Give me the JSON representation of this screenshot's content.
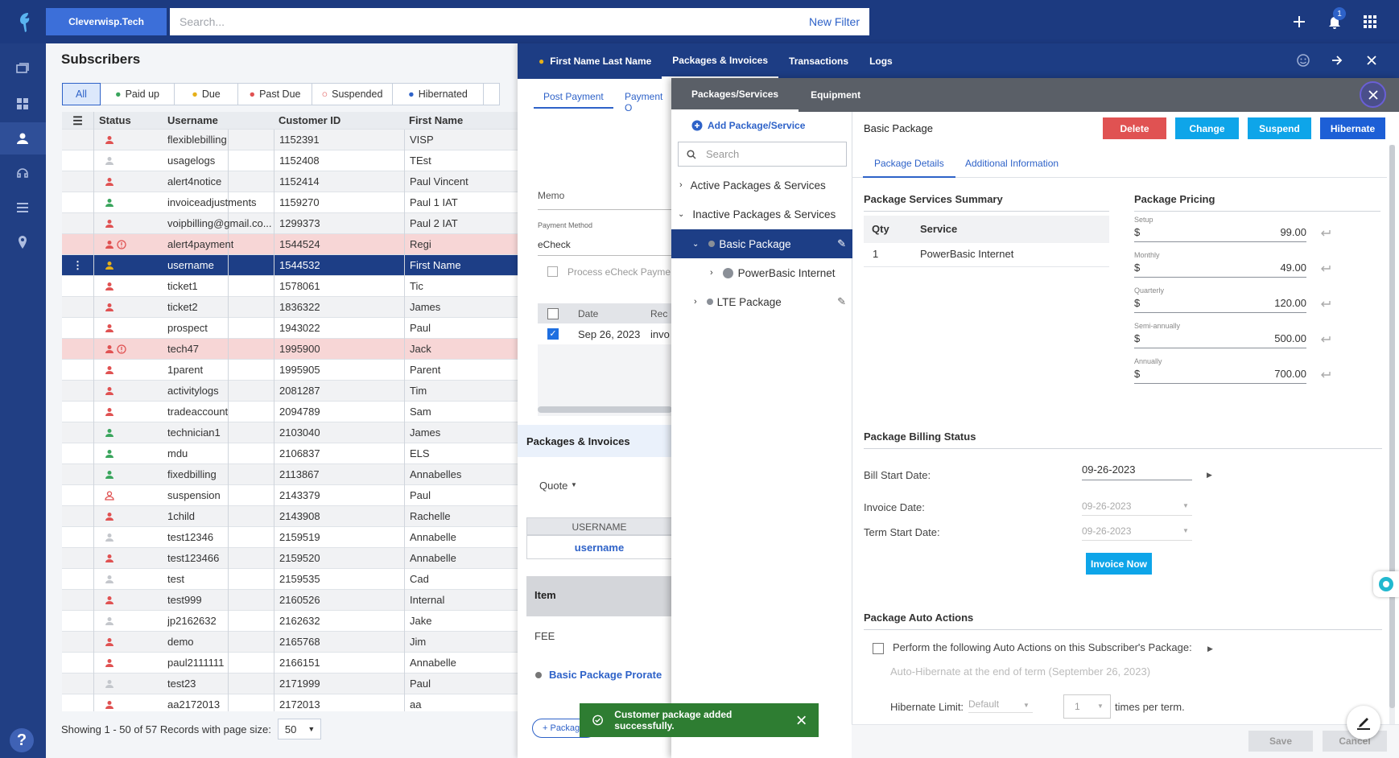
{
  "topbar": {
    "company": "Cleverwisp.Tech",
    "search_placeholder": "Search...",
    "new_filter": "New Filter",
    "notif_count": "1"
  },
  "subscribers": {
    "title": "Subscribers",
    "filters": [
      "All",
      "Paid up",
      "Due",
      "Past Due",
      "Suspended",
      "Hibernated"
    ],
    "columns": [
      "Status",
      "Username",
      "Customer ID",
      "First Name"
    ],
    "rows": [
      {
        "username": "flexiblebilling",
        "id": "1152391",
        "first": "VISP",
        "status": "red"
      },
      {
        "username": "usagelogs",
        "id": "1152408",
        "first": "TEst",
        "status": "gray"
      },
      {
        "username": "alert4notice",
        "id": "1152414",
        "first": "Paul Vincent",
        "status": "red"
      },
      {
        "username": "invoiceadjustments",
        "id": "1159270",
        "first": "Paul 1 IAT",
        "status": "green"
      },
      {
        "username": "voipbilling@gmail.co...",
        "id": "1299373",
        "first": "Paul 2 IAT",
        "status": "red"
      },
      {
        "username": "alert4payment",
        "id": "1544524",
        "first": "Regi",
        "status": "red-alert"
      },
      {
        "username": "username",
        "id": "1544532",
        "first": "First Name",
        "status": "yellow"
      },
      {
        "username": "ticket1",
        "id": "1578061",
        "first": "Tic",
        "status": "red"
      },
      {
        "username": "ticket2",
        "id": "1836322",
        "first": "James",
        "status": "red"
      },
      {
        "username": "prospect",
        "id": "1943022",
        "first": "Paul",
        "status": "red"
      },
      {
        "username": "tech47",
        "id": "1995900",
        "first": "Jack",
        "status": "red-alert"
      },
      {
        "username": "1parent",
        "id": "1995905",
        "first": "Parent",
        "status": "red"
      },
      {
        "username": "activitylogs",
        "id": "2081287",
        "first": "Tim",
        "status": "red"
      },
      {
        "username": "tradeaccount",
        "id": "2094789",
        "first": "Sam",
        "status": "red"
      },
      {
        "username": "technician1",
        "id": "2103040",
        "first": "James",
        "status": "green"
      },
      {
        "username": "mdu",
        "id": "2106837",
        "first": "ELS",
        "status": "green"
      },
      {
        "username": "fixedbilling",
        "id": "2113867",
        "first": "Annabelles",
        "status": "green"
      },
      {
        "username": "suspension",
        "id": "2143379",
        "first": "Paul",
        "status": "outline"
      },
      {
        "username": "1child",
        "id": "2143908",
        "first": "Rachelle",
        "status": "red"
      },
      {
        "username": "test12346",
        "id": "2159519",
        "first": "Annabelle",
        "status": "gray"
      },
      {
        "username": "test123466",
        "id": "2159520",
        "first": "Annabelle",
        "status": "red"
      },
      {
        "username": "test",
        "id": "2159535",
        "first": "Cad",
        "status": "gray"
      },
      {
        "username": "test999",
        "id": "2160526",
        "first": "Internal",
        "status": "red"
      },
      {
        "username": "jp2162632",
        "id": "2162632",
        "first": "Jake",
        "status": "gray"
      },
      {
        "username": "demo",
        "id": "2165768",
        "first": "Jim",
        "status": "red"
      },
      {
        "username": "paul2111111",
        "id": "2166151",
        "first": "Annabelle",
        "status": "red"
      },
      {
        "username": "test23",
        "id": "2171999",
        "first": "Paul",
        "status": "gray"
      },
      {
        "username": "aa2172013",
        "id": "2172013",
        "first": "aa",
        "status": "red"
      }
    ],
    "pager": "Showing 1 - 50 of 57 Records with page size:",
    "page_size": "50"
  },
  "detail": {
    "tabs": [
      "First Name Last Name",
      "Packages & Invoices",
      "Transactions",
      "Logs"
    ],
    "post_payment": "Post Payment",
    "payment_other": "Payment O",
    "memo": "Memo",
    "payment_method_label": "Payment Method",
    "payment_method": "eCheck",
    "process_echeck": "Process eCheck Payme",
    "date_col": "Date",
    "rec_col": "Rec",
    "date_val": "Sep 26, 2023",
    "inv_val": "invo",
    "packages_invoices": "Packages & Invoices",
    "quote": "Quote",
    "username_col": "USERNAME",
    "username_val": "username",
    "item_col": "Item",
    "fee": "FEE",
    "prorate": "Basic Package Prorate",
    "add_pkg": "+ Packag"
  },
  "packages": {
    "tabs": [
      "Packages/Services",
      "Equipment"
    ],
    "add": "Add Package/Service",
    "search_placeholder": "Search",
    "tree": [
      "Active Packages & Services",
      "Inactive Packages & Services",
      "Basic Package",
      "PowerBasic Internet",
      "LTE Package"
    ],
    "title": "Basic Package",
    "actions": {
      "delete": "Delete",
      "change": "Change",
      "suspend": "Suspend",
      "hibernate": "Hibernate"
    },
    "subtabs": [
      "Package Details",
      "Additional Information"
    ],
    "summary_title": "Package Services Summary",
    "qty": "Qty",
    "service": "Service",
    "svc_qty": "1",
    "svc_name": "PowerBasic Internet",
    "pricing_title": "Package Pricing",
    "pricing": [
      {
        "label": "Setup",
        "value": "99.00"
      },
      {
        "label": "Monthly",
        "value": "49.00"
      },
      {
        "label": "Quarterly",
        "value": "120.00"
      },
      {
        "label": "Semi-annually",
        "value": "500.00"
      },
      {
        "label": "Annually",
        "value": "700.00"
      }
    ],
    "currency": "$",
    "billing_title": "Package Billing Status",
    "bill_start_label": "Bill Start Date:",
    "bill_start": "09-26-2023",
    "invoice_date_label": "Invoice Date:",
    "invoice_date": "09-26-2023",
    "term_start_label": "Term Start Date:",
    "term_start": "09-26-2023",
    "invoice_now": "Invoice Now",
    "auto_title": "Package Auto Actions",
    "auto_check": "Perform the following Auto Actions on this Subscriber's Package:",
    "auto_hib": "Auto-Hibernate at the end of term (September 26, 2023)",
    "hib_limit": "Hibernate Limit:",
    "hib_default": "Default",
    "hib_times_val": "1",
    "hib_times": "times per term.",
    "save": "Save",
    "cancel": "Cancel"
  },
  "toast": "Customer package added successfully.",
  "colors": {
    "navy": "#1c3a80",
    "blue": "#0d6efd",
    "red": "#e05252",
    "green": "#2e7d32"
  }
}
